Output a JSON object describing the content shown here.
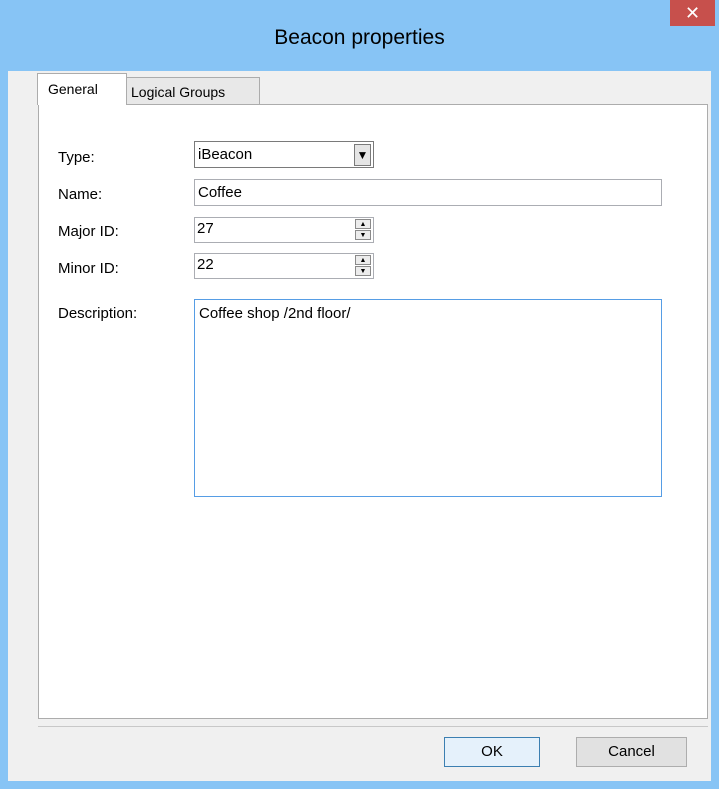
{
  "window": {
    "title": "Beacon properties",
    "close_glyph": "✕"
  },
  "tabs": [
    {
      "label": "General",
      "selected": true
    },
    {
      "label": "Logical Groups",
      "selected": false
    }
  ],
  "form": {
    "type": {
      "label": "Type:",
      "value": "iBeacon",
      "arrow": "▼"
    },
    "name": {
      "label": "Name:",
      "value": "Coffee"
    },
    "major_id": {
      "label": "Major ID:",
      "value": "27"
    },
    "minor_id": {
      "label": "Minor ID:",
      "value": "22"
    },
    "description": {
      "label": "Description:",
      "value": "Coffee shop /2nd floor/"
    }
  },
  "buttons": {
    "ok": "OK",
    "cancel": "Cancel"
  },
  "colors": {
    "titlebar": "#87c4f5",
    "close": "#c7504c",
    "focus_border": "#569de5"
  },
  "icons": {
    "close": "close-icon",
    "spin_up": "spin-up-icon",
    "spin_down": "spin-down-icon",
    "dropdown": "chevron-down-icon"
  }
}
